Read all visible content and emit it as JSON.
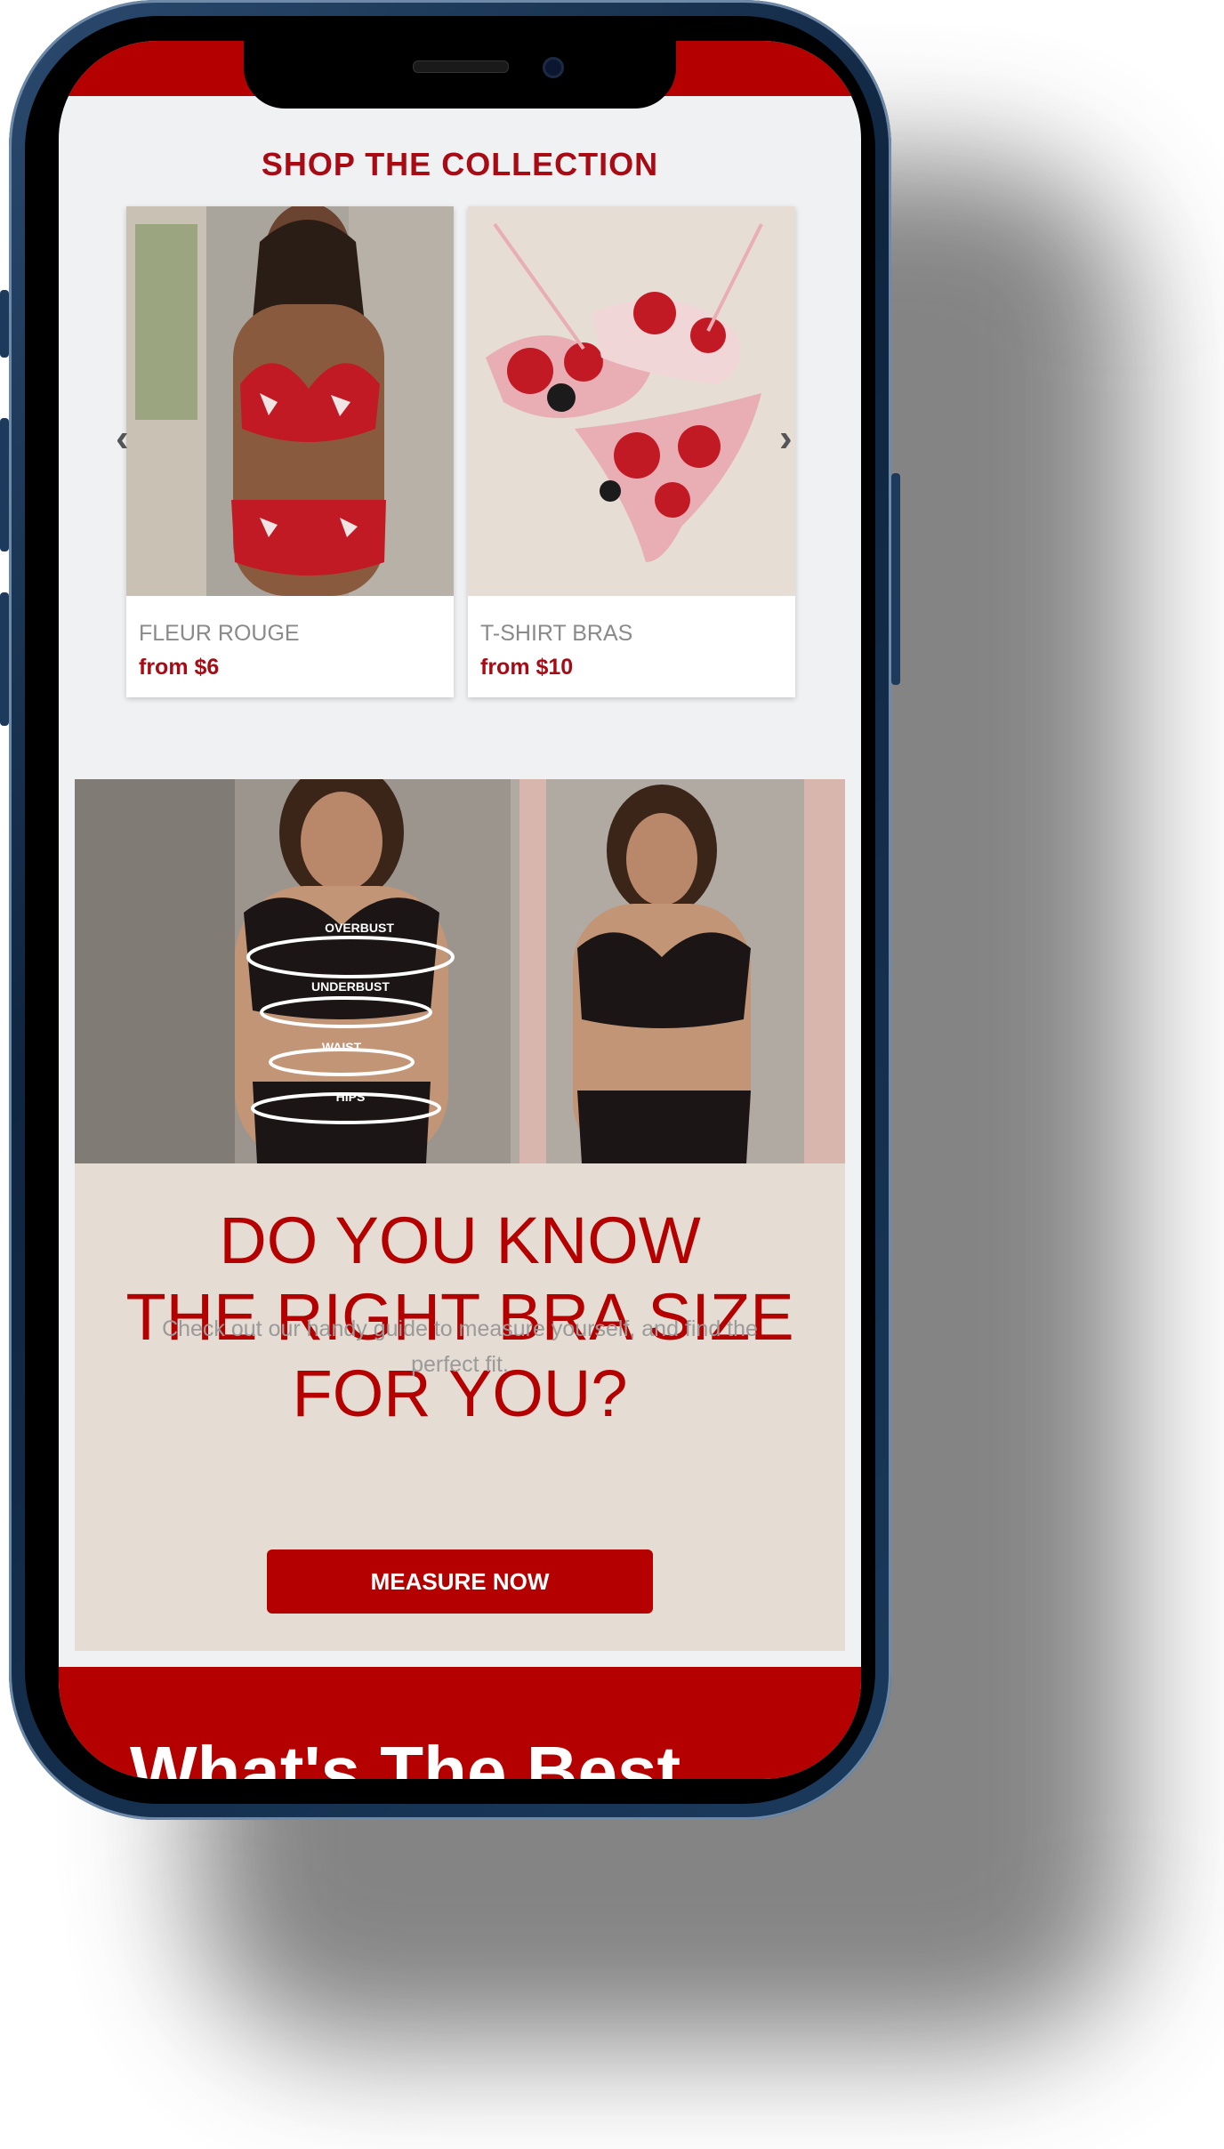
{
  "collection": {
    "heading": "SHOP THE COLLECTION",
    "prev_icon": "chevron-left-icon",
    "next_icon": "chevron-right-icon",
    "cards": [
      {
        "name": "FLEUR ROUGE",
        "price": "from $6"
      },
      {
        "name": "T-SHIRT BRAS",
        "price": "from $10"
      }
    ]
  },
  "fit_guide": {
    "image_labels": [
      "OVERBUST",
      "UNDERBUST",
      "WAIST",
      "HIPS"
    ],
    "title_line1": "DO YOU KNOW",
    "title_line2": "THE RIGHT BRA SIZE",
    "title_line3": "FOR YOU?",
    "description": "Check out our handy guide to measure yourself, and find the perfect fit.",
    "button_label": "MEASURE NOW"
  },
  "next_section": {
    "title": "What's The Best"
  },
  "colors": {
    "brand_red": "#b50000",
    "heading_red": "#a80b14",
    "section_beige": "#e5ddd3",
    "page_bg": "#f0f1f3"
  }
}
